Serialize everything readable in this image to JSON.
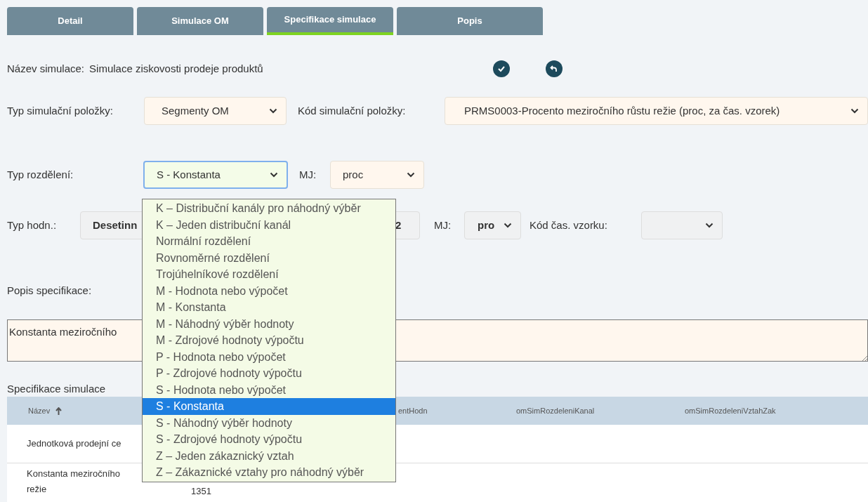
{
  "tabs": [
    {
      "label": "Detail",
      "selected": false
    },
    {
      "label": "Simulace OM",
      "selected": false
    },
    {
      "label": "Specifikace simulace",
      "selected": true
    },
    {
      "label": "Popis",
      "selected": false
    }
  ],
  "simulation_name": {
    "label": "Název simulace:",
    "value": "Simulace ziskovosti prodeje produktů"
  },
  "item_type": {
    "label": "Typ simulační položky:",
    "value": "Segmenty OM"
  },
  "item_code": {
    "label": "Kód simulační položky:",
    "value": "PRMS0003-Procento meziročního růstu režie (proc, za čas. vzorek)"
  },
  "distribution_type": {
    "label": "Typ rozdělení:",
    "value": "S - Konstanta",
    "expanded": true
  },
  "distribution_unit": {
    "label": "MJ:",
    "value": "proc"
  },
  "value_type": {
    "label": "Typ hodn.:",
    "value": "Desetinn"
  },
  "value_field": {
    "value": "2"
  },
  "value_unit": {
    "label": "MJ:",
    "value": "pro"
  },
  "time_sample": {
    "label": "Kód čas. vzorku:"
  },
  "description": {
    "label": "Popis specifikace:",
    "value": "Konstanta meziročního"
  },
  "table": {
    "title": "Specifikace simulace",
    "columns": [
      "Název",
      "entHodn",
      "omSimRozdeleniKanal",
      "omSimRozdeleniVztahZak"
    ],
    "rows": [
      {
        "name_lines": [
          "Jednotková prodejní ce"
        ]
      },
      {
        "name_lines": [
          "Konstanta meziročního",
          "režie"
        ],
        "column_2": "1351"
      }
    ]
  },
  "dropdown_options": [
    {
      "label": "K – Distribuční kanály pro náhodný výběr",
      "selected": false
    },
    {
      "label": "K – Jeden distribuční kanál",
      "selected": false
    },
    {
      "label": "Normální rozdělení",
      "selected": false
    },
    {
      "label": "Rovnoměrné rozdělení",
      "selected": false
    },
    {
      "label": "Trojúhelníkové rozdělení",
      "selected": false
    },
    {
      "label": "M - Hodnota nebo výpočet",
      "selected": false
    },
    {
      "label": "M - Konstanta",
      "selected": false
    },
    {
      "label": "M - Náhodný výběr hodnoty",
      "selected": false
    },
    {
      "label": "M - Zdrojové hodnoty výpočtu",
      "selected": false
    },
    {
      "label": "P - Hodnota nebo výpočet",
      "selected": false
    },
    {
      "label": "P - Zdrojové hodnoty výpočtu",
      "selected": false
    },
    {
      "label": "S - Hodnota nebo výpočet",
      "selected": false
    },
    {
      "label": "S - Konstanta",
      "selected": true
    },
    {
      "label": "S - Náhodný výběr hodnoty",
      "selected": false
    },
    {
      "label": "S - Zdrojové hodnoty výpočtu",
      "selected": false
    },
    {
      "label": "Z –  Jeden zákaznický vztah",
      "selected": false
    },
    {
      "label": "Z – Zákaznické vztahy pro náhodný výběr",
      "selected": false
    }
  ]
}
